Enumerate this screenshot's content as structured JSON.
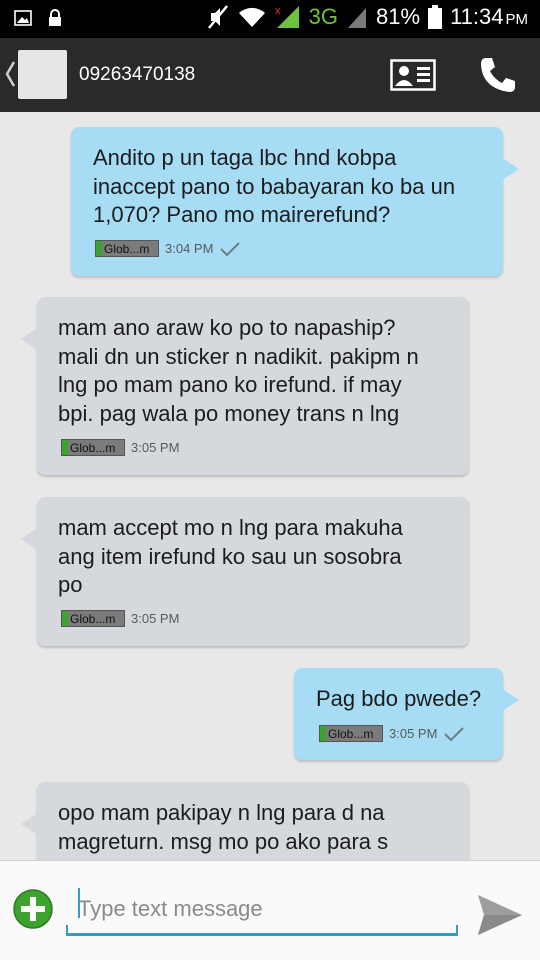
{
  "status_bar": {
    "network": "3G",
    "battery": "81%",
    "time": "11:34",
    "ampm": "PM",
    "icons": [
      "image-icon",
      "lock-icon",
      "mute-icon",
      "wifi-icon",
      "signal-icon",
      "battery-icon"
    ]
  },
  "header": {
    "contact_number": "09263470138",
    "icons": [
      "back-chevron-icon",
      "contact-card-icon",
      "phone-icon"
    ]
  },
  "messages": [
    {
      "direction": "sent",
      "text": "Andito p un taga lbc hnd kobpa\ninaccept pano to babayaran ko ba un\n1,070? Pano mo mairerefund?",
      "carrier": "Glob...m",
      "time": "3:04 PM",
      "delivered": true
    },
    {
      "direction": "received",
      "text": "mam ano araw ko po to napaship?\nmali dn un sticker n nadikit. pakipm n\nlng po mam pano ko irefund. if may\nbpi. pag wala po money trans n lng",
      "carrier": "Glob...m",
      "time": "3:05 PM"
    },
    {
      "direction": "received",
      "text": "mam accept mo n lng para makuha\nang item irefund ko sau un sosobra\npo",
      "carrier": "Glob...m",
      "time": "3:05 PM"
    },
    {
      "direction": "sent",
      "text": "Pag bdo pwede?",
      "carrier": "Glob...m",
      "time": "3:05 PM",
      "delivered": true
    },
    {
      "direction": "received",
      "text": "opo mam pakipay n lng para d na\nmagreturn. msg mo po ako para s",
      "carrier": "",
      "time": ""
    }
  ],
  "composer": {
    "placeholder": "Type text message",
    "value": ""
  },
  "colors": {
    "sent_bubble": "#a6dcf4",
    "received_bubble": "#d5d8dc",
    "header_bg": "#2a2a2a",
    "accent": "#3a98c9",
    "add_button": "#3ea22f"
  }
}
